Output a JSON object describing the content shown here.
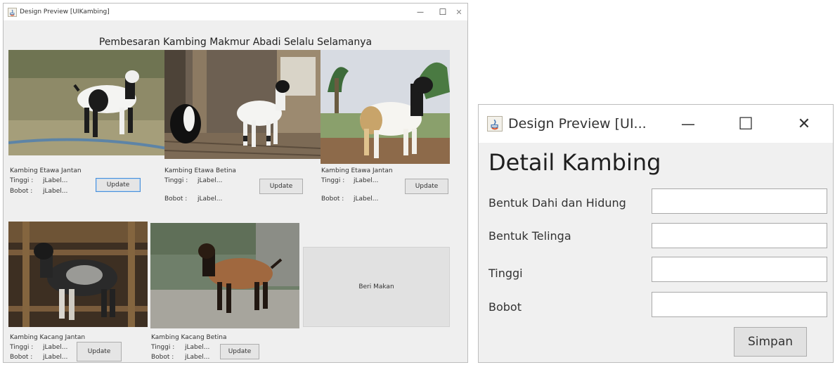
{
  "left_window": {
    "title": "Design Preview [UIKambing]",
    "controls": {
      "minimize": "—",
      "maximize": "☐",
      "close": "✕"
    },
    "heading": "Pembesaran Kambing Makmur Abadi Selalu Selamanya",
    "tinggi_label": "Tinggi :",
    "bobot_label": "Bobot :",
    "value_placeholder": "jLabel...",
    "update_label": "Update",
    "cards": [
      {
        "name": "Kambing Etawa Jantan"
      },
      {
        "name": "Kambing Etawa Betina"
      },
      {
        "name": "Kambing Etawa Jantan"
      },
      {
        "name": "Kambing Kacang Jantan"
      },
      {
        "name": "Kambing Kacang Betina"
      }
    ],
    "feed_button": "Beri Makan"
  },
  "right_window": {
    "title": "Design Preview [UI...",
    "controls": {
      "minimize": "—",
      "maximize": "☐",
      "close": "✕"
    },
    "heading": "Detail Kambing",
    "fields": [
      {
        "label": "Bentuk Dahi dan Hidung",
        "value": ""
      },
      {
        "label": "Bentuk Telinga",
        "value": ""
      },
      {
        "label": "Tinggi",
        "value": ""
      },
      {
        "label": "Bobot",
        "value": ""
      }
    ],
    "save_button": "Simpan"
  },
  "colors": {
    "focus_border": "#4a90d9",
    "panel_bg": "#efefef"
  }
}
